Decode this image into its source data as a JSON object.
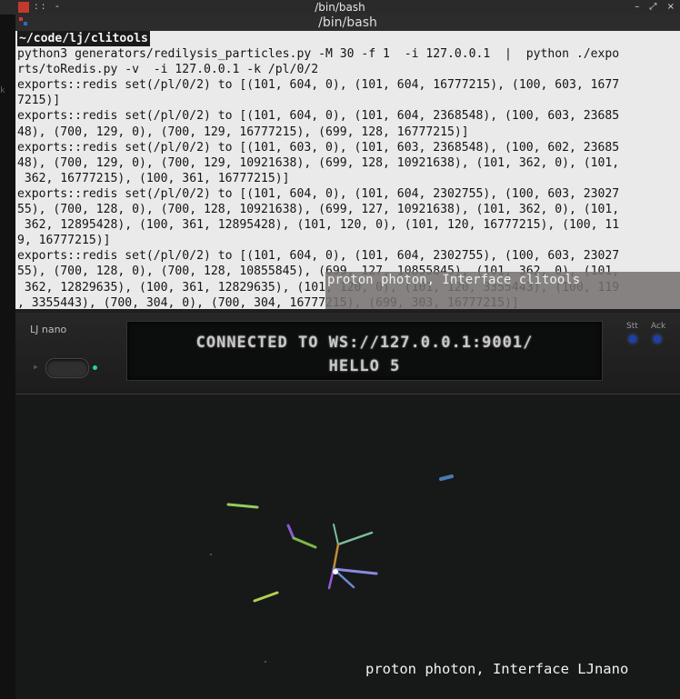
{
  "window": {
    "title": "/bin/bash",
    "left_controls": "::  -",
    "controls": [
      "–",
      "⤢",
      "×"
    ]
  },
  "terminal": {
    "tab_title": "/bin/bash",
    "prompt": "~/code/lj/clitools",
    "lines": [
      "python3 generators/redilysis_particles.py -M 30 -f 1  -i 127.0.0.1  |  python ./expo",
      "rts/toRedis.py -v  -i 127.0.0.1 -k /pl/0/2",
      "exports::redis set(/pl/0/2) to [(101, 604, 0), (101, 604, 16777215), (100, 603, 1677",
      "7215)]",
      "exports::redis set(/pl/0/2) to [(101, 604, 0), (101, 604, 2368548), (100, 603, 23685",
      "48), (700, 129, 0), (700, 129, 16777215), (699, 128, 16777215)]",
      "exports::redis set(/pl/0/2) to [(101, 603, 0), (101, 603, 2368548), (100, 602, 23685",
      "48), (700, 129, 0), (700, 129, 10921638), (699, 128, 10921638), (101, 362, 0), (101,",
      " 362, 16777215), (100, 361, 16777215)]",
      "exports::redis set(/pl/0/2) to [(101, 604, 0), (101, 604, 2302755), (100, 603, 23027",
      "55), (700, 128, 0), (700, 128, 10921638), (699, 127, 10921638), (101, 362, 0), (101,",
      " 362, 12895428), (100, 361, 12895428), (101, 120, 0), (101, 120, 16777215), (100, 11",
      "9, 16777215)]",
      "exports::redis set(/pl/0/2) to [(101, 604, 0), (101, 604, 2302755), (100, 603, 23027",
      "55), (700, 128, 0), (700, 128, 10855845), (699, 127, 10855845), (101, 362, 0), (101,",
      " 362, 12829635), (100, 361, 12829635), (101, 120, 0), (101, 120, 3355443), (100, 119",
      ", 3355443), (700, 304, 0), (700, 304, 16777215), (699, 303, 16777215)]"
    ],
    "overlay_caption": "proton photon, Interface clitools"
  },
  "ljnano": {
    "label": "LJ nano",
    "display_line1": "CONNECTED TO WS://127.0.0.1:9001/",
    "display_line2": "HELLO 5",
    "led1_label": "Stt",
    "led2_label": "Ack",
    "led_color": "#1d3fa8"
  },
  "viz": {
    "caption": "proton photon, Interface LJnano"
  },
  "left_strip": {
    "glyph": "k"
  }
}
